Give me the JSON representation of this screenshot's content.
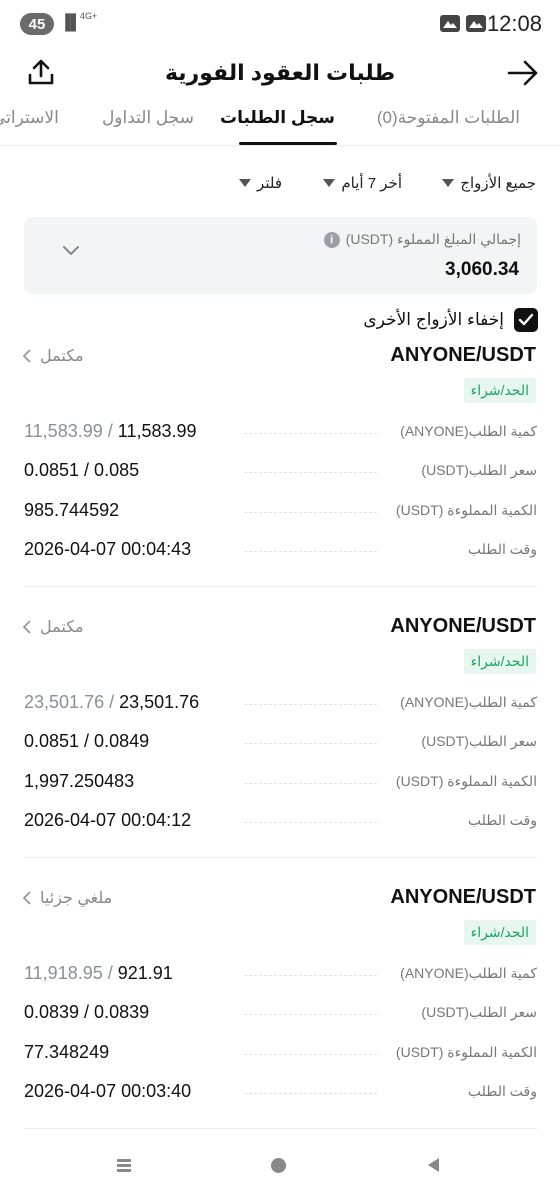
{
  "status_bar": {
    "battery": "45",
    "network": "4G+",
    "time": "12:08"
  },
  "header": {
    "title": "طلبات العقود الفورية"
  },
  "tabs": [
    {
      "label": "الطلبات المفتوحة(0)",
      "active": false
    },
    {
      "label": "سجل الطلبات",
      "active": true
    },
    {
      "label": "سجل التداول",
      "active": false
    },
    {
      "label": "الاستراتي",
      "active": false
    }
  ],
  "filters": {
    "pairs": "جميع الأزواج",
    "period": "أخر 7 أيام",
    "filter": "فلتر"
  },
  "summary": {
    "label": "إجمالي المبلغ المملوء (USDT)",
    "value": "3,060.34"
  },
  "hide_other_pairs": {
    "label": "إخفاء الأزواج الأخرى",
    "checked": true
  },
  "field_labels": {
    "quantity": "كمية الطلب(ANYONE)",
    "price": "سعر الطلب(USDT)",
    "filled": "الكمية المملوءة (USDT)",
    "time": "وقت الطلب"
  },
  "orders": [
    {
      "pair": "ANYONE/USDT",
      "status": "مكتمل",
      "type": "الحد/شراء",
      "quantity_total": "11,583.99",
      "quantity_filled": "11,583.99",
      "price": "0.0851 / 0.085",
      "filled_amount": "985.744592",
      "time": "2026-04-07 00:04:43"
    },
    {
      "pair": "ANYONE/USDT",
      "status": "مكتمل",
      "type": "الحد/شراء",
      "quantity_total": "23,501.76",
      "quantity_filled": "23,501.76",
      "price": "0.0851 / 0.0849",
      "filled_amount": "1,997.250483",
      "time": "2026-04-07 00:04:12"
    },
    {
      "pair": "ANYONE/USDT",
      "status": "ملغي جزئيا",
      "type": "الحد/شراء",
      "quantity_total": "11,918.95",
      "quantity_filled": "921.91",
      "price": "0.0839 / 0.0839",
      "filled_amount": "77.348249",
      "time": "2026-04-07 00:03:40"
    }
  ],
  "colors": {
    "accent_green": "#1aa663",
    "badge_bg": "#e7f6ee",
    "muted_text": "#8a8f98"
  }
}
